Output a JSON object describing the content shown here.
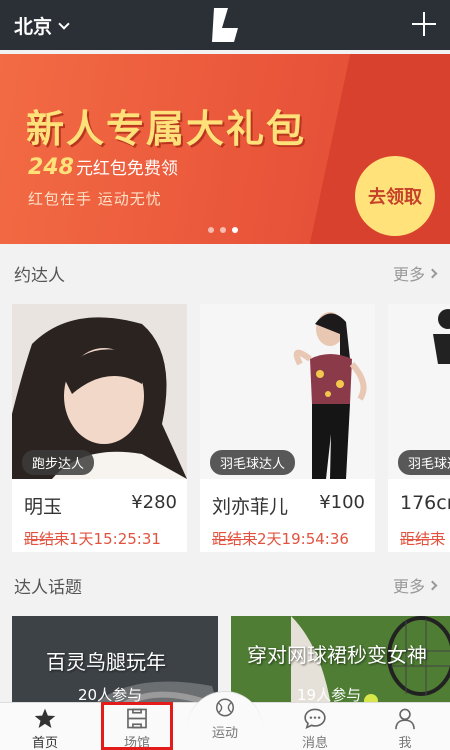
{
  "header": {
    "city": "北京",
    "logo_icon": "app-logo-icon",
    "add_icon": "plus-icon"
  },
  "banner": {
    "title": "新人专属大礼包",
    "amount": "248",
    "offer_text": "元红包免费领",
    "note": "红包在手 运动无忧",
    "cta": "去领取",
    "dots_total": 3,
    "dots_active": 3
  },
  "experts": {
    "title": "约达人",
    "more": "更多",
    "cards": [
      {
        "tag": "跑步达人",
        "name": "明玉",
        "price": "¥280",
        "countdown_label": "距结束",
        "countdown": "1天15:25:31"
      },
      {
        "tag": "羽毛球达人",
        "name": "刘亦菲儿",
        "price": "¥100",
        "countdown_label": "距结束",
        "countdown": "2天19:54:36"
      },
      {
        "tag": "羽毛球达",
        "name": "176cm",
        "price": "",
        "countdown_label": "距结束",
        "countdown": ""
      }
    ]
  },
  "topics": {
    "title": "达人话题",
    "more": "更多",
    "items": [
      {
        "title": "百灵鸟腿玩年",
        "count": "20人参与"
      },
      {
        "title": "穿对网球裙秒变女神",
        "count": "19人参与"
      }
    ]
  },
  "bottom_nav": {
    "items": [
      {
        "label": "首页",
        "icon": "star-icon",
        "active": true
      },
      {
        "label": "场馆",
        "icon": "stadium-icon",
        "active": false
      },
      {
        "label": "运动",
        "icon": "ball-icon",
        "active": false
      },
      {
        "label": "消息",
        "icon": "chat-bubble-icon",
        "active": false
      },
      {
        "label": "我",
        "icon": "person-icon",
        "active": false
      }
    ]
  },
  "colors": {
    "topbar": "#2b2f36",
    "banner": "#e9553a",
    "accent_yellow": "#ffe17a",
    "countdown": "#e2523f",
    "highlight": "#e31b1b"
  }
}
